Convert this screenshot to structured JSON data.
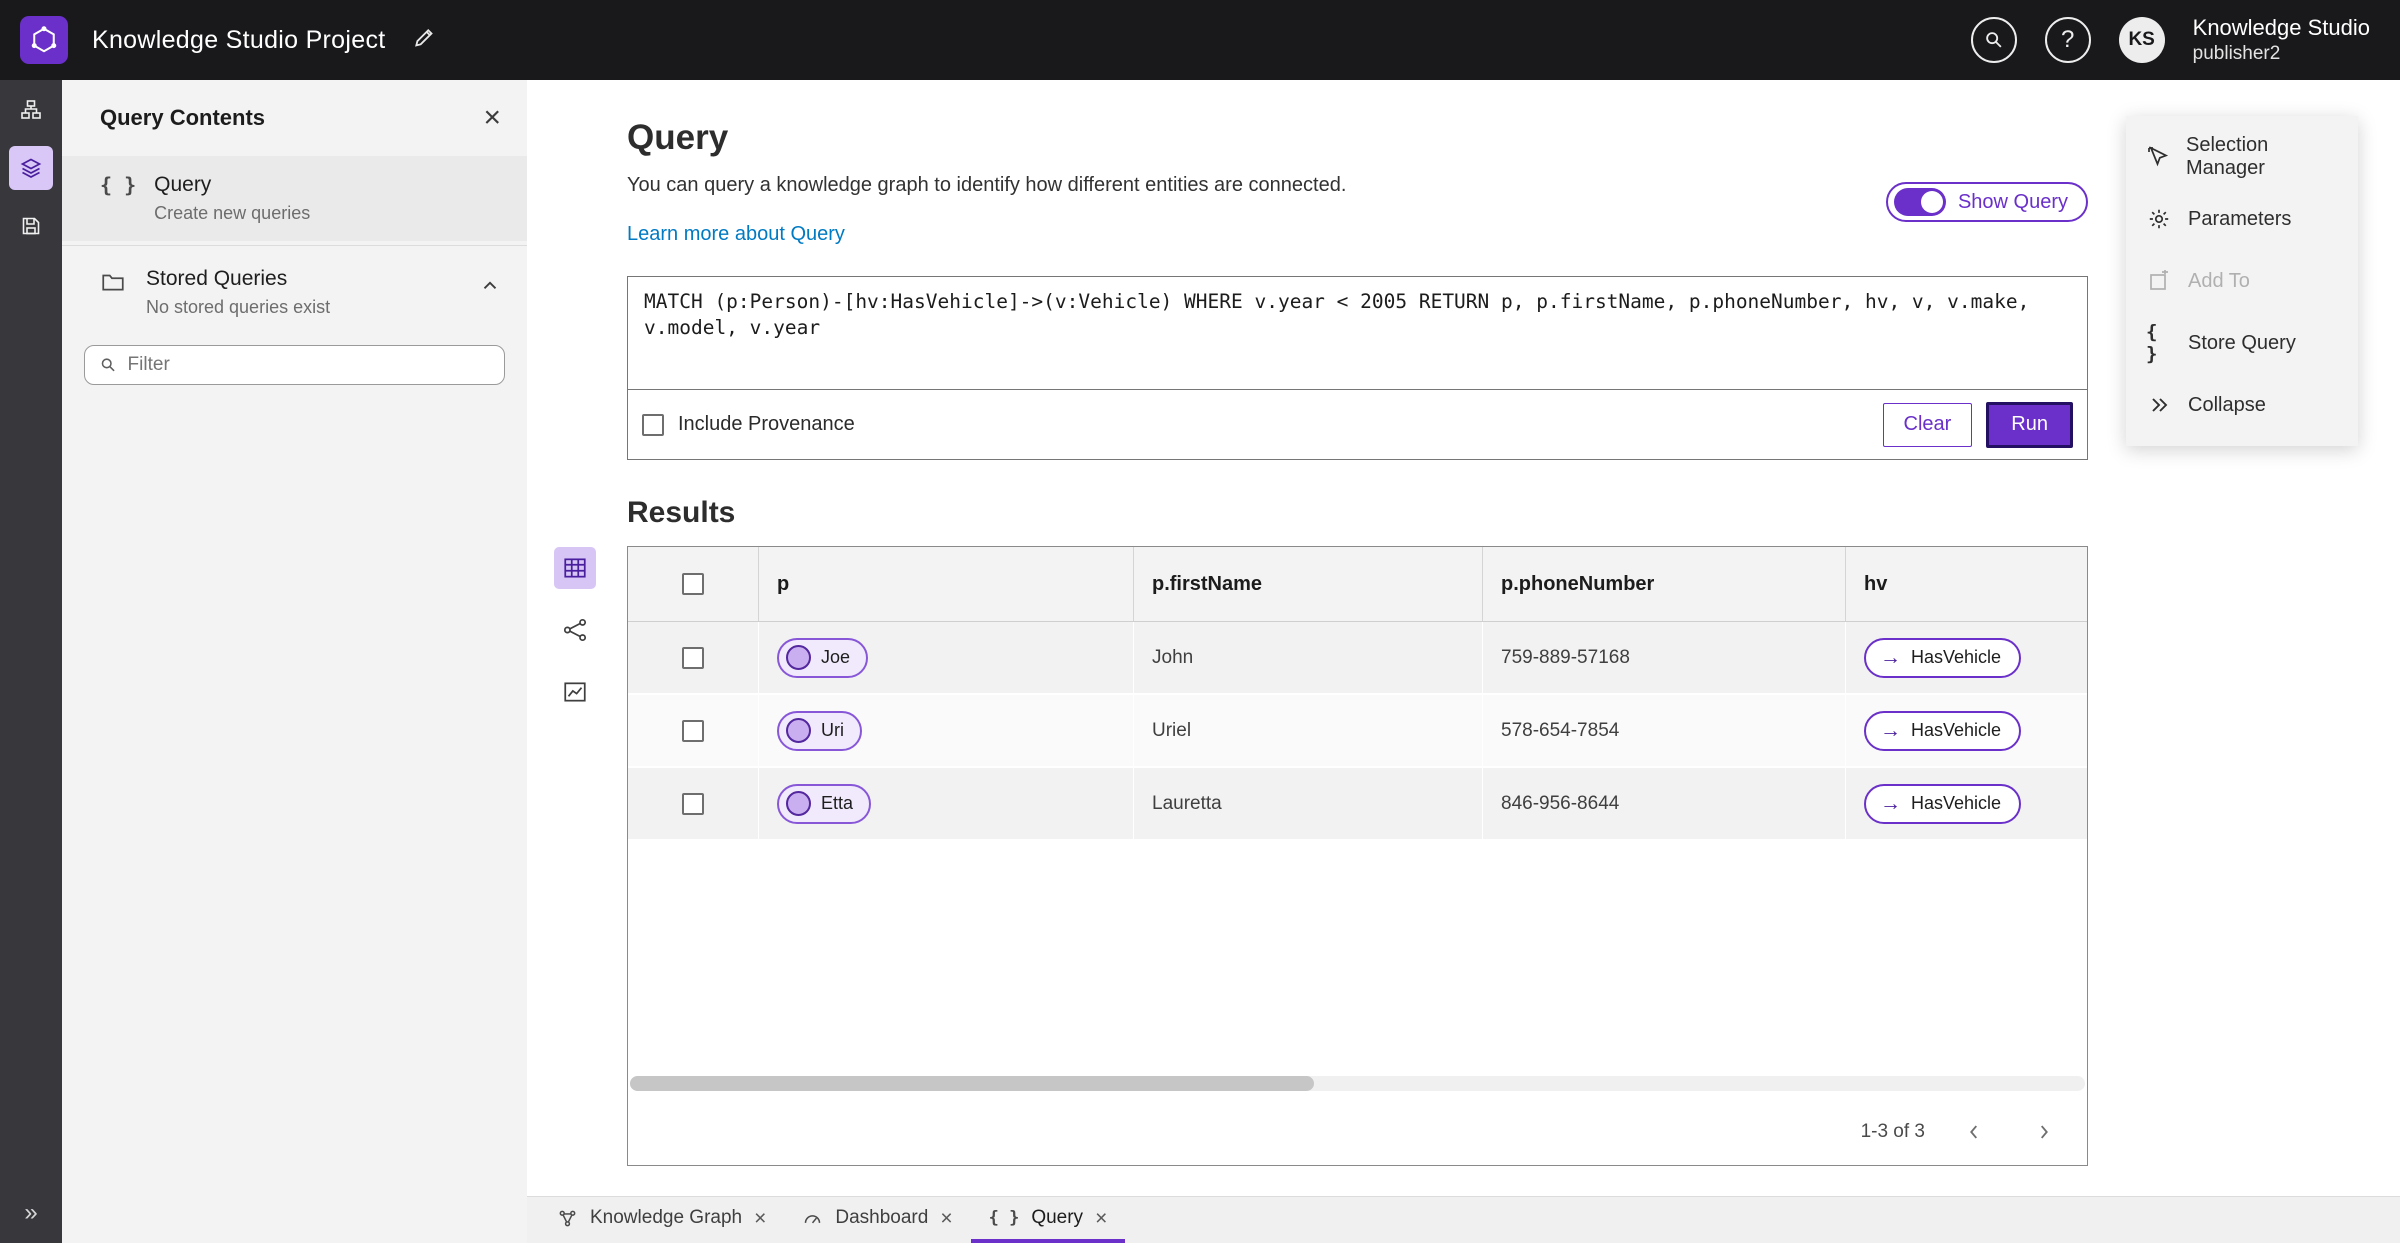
{
  "colors": {
    "accent": "#6a30c9",
    "accent_dark": "#4a1f9e",
    "link": "#007ac2",
    "topbar": "#19191c"
  },
  "icons": {
    "braces": "{ }",
    "arrow_right": "→",
    "close": "×",
    "chevrons_right": "»"
  },
  "header": {
    "title": "Knowledge Studio Project",
    "app_name": "Knowledge Studio",
    "user_role": "publisher2",
    "avatar_initials": "KS"
  },
  "left_panel": {
    "title": "Query Contents",
    "query_item": {
      "title": "Query",
      "subtitle": "Create new queries"
    },
    "stored_queries": {
      "title": "Stored Queries",
      "subtitle": "No stored queries exist"
    },
    "filter_placeholder": "Filter"
  },
  "query_section": {
    "heading": "Query",
    "description": "You can query a knowledge graph to identify how different entities are connected.",
    "learn_more_label": "Learn more about Query",
    "show_query_label": "Show Query",
    "query_text": "MATCH (p:Person)-[hv:HasVehicle]->(v:Vehicle) WHERE v.year < 2005 RETURN p, p.firstName, p.phoneNumber, hv, v, v.make, v.model, v.year",
    "include_provenance_label": "Include Provenance",
    "clear_label": "Clear",
    "run_label": "Run"
  },
  "results": {
    "heading": "Results",
    "columns": [
      "p",
      "p.firstName",
      "p.phoneNumber",
      "hv"
    ],
    "rows": [
      {
        "p": "Joe",
        "firstName": "John",
        "phoneNumber": "759-889-57168",
        "hv": "HasVehicle"
      },
      {
        "p": "Uri",
        "firstName": "Uriel",
        "phoneNumber": "578-654-7854",
        "hv": "HasVehicle"
      },
      {
        "p": "Etta",
        "firstName": "Lauretta",
        "phoneNumber": "846-956-8644",
        "hv": "HasVehicle"
      }
    ],
    "pagination": "1-3 of 3"
  },
  "actions_panel": {
    "items": [
      {
        "label": "Selection Manager"
      },
      {
        "label": "Parameters"
      },
      {
        "label": "Add To",
        "disabled": true
      },
      {
        "label": "Store Query"
      },
      {
        "label": "Collapse"
      }
    ]
  },
  "tabs": [
    {
      "label": "Knowledge Graph"
    },
    {
      "label": "Dashboard"
    },
    {
      "label": "Query",
      "active": true
    }
  ]
}
